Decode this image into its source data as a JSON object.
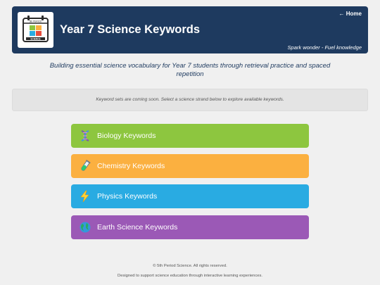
{
  "header": {
    "title": "Year 7 Science Keywords",
    "home_link": "← Home",
    "tagline": "Spark wonder - Fuel knowledge",
    "logo": {
      "top_text": "5th PERIOD",
      "bottom_text": "SCIENCE"
    }
  },
  "subtitle": "Building essential science vocabulary for Year 7 students through retrieval practice and spaced repetition",
  "notice": "Keyword sets are coming soon. Select a science strand below to explore available keywords.",
  "strands": [
    {
      "label": "Biology Keywords",
      "color": "#8dc63f",
      "icon": "dna-icon"
    },
    {
      "label": "Chemistry Keywords",
      "color": "#fbb040",
      "icon": "test-tube-icon"
    },
    {
      "label": "Physics Keywords",
      "color": "#29abe2",
      "icon": "lightning-icon"
    },
    {
      "label": "Earth Science Keywords",
      "color": "#9b59b6",
      "icon": "globe-icon"
    }
  ],
  "footer": {
    "copyright": "© 5th Period Science. All rights reserved.",
    "description": "Designed to support science education through interactive learning experiences."
  },
  "colors": {
    "header_bg": "#1e3a5f",
    "page_bg": "#f0f0f0",
    "notice_bg": "#e4e4e4"
  }
}
